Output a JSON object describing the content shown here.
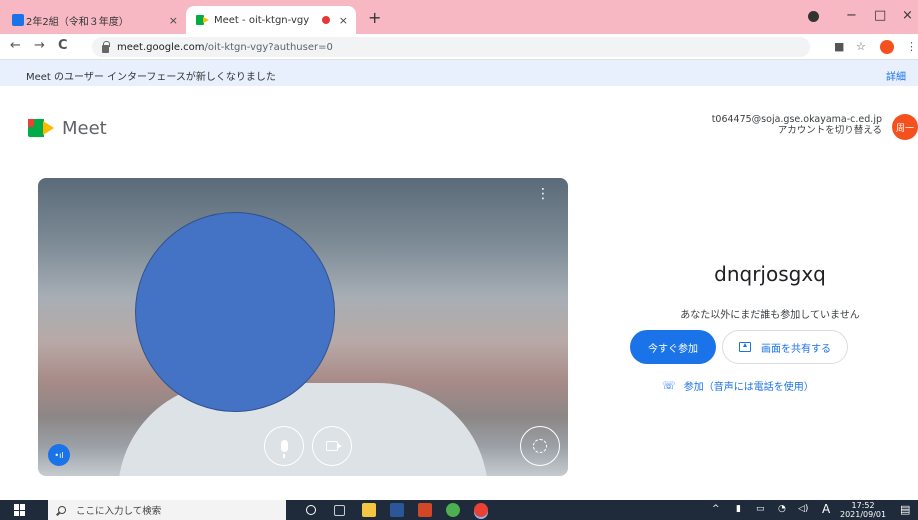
{
  "browser": {
    "tabs": [
      {
        "title": "2年2組（令和３年度）",
        "close": "×"
      },
      {
        "title": "Meet - oit-ktgn-vgy",
        "close": "×"
      }
    ],
    "new_tab": "+",
    "window_controls": {
      "minimize": "−",
      "maximize": "□",
      "close": "×"
    },
    "nav": {
      "back": "←",
      "forward": "→",
      "reload": "C"
    },
    "url_host": "meet.google.com",
    "url_path": "/oit-ktgn-vgy?authuser=0"
  },
  "banner": {
    "message": "Meet のユーザー インターフェースが新しくなりました",
    "link": "詳細"
  },
  "header": {
    "app_name": "Meet",
    "account_email": "t064475@soja.gse.okayama-c.ed.jp",
    "switch_account": "アカウントを切り替える",
    "avatar_text": "周一"
  },
  "video": {
    "menu": "⋮",
    "people_badge": "•ıl"
  },
  "join": {
    "meeting_code": "dnqrjosgxq",
    "status": "あなた以外にまだ誰も参加していません",
    "join_now": "今すぐ参加",
    "present": "画面を共有する",
    "phone_join": "参加（音声には電話を使用）"
  },
  "taskbar": {
    "search_placeholder": "ここに入力して検索",
    "ime": "A",
    "time": "17:52",
    "date": "2021/09/01"
  },
  "colors": {
    "accent": "#1a73e8",
    "tab_strip": "#f7b8c4",
    "banner_bg": "#e8f0fe",
    "taskbar_bg": "#1f2a3b"
  }
}
